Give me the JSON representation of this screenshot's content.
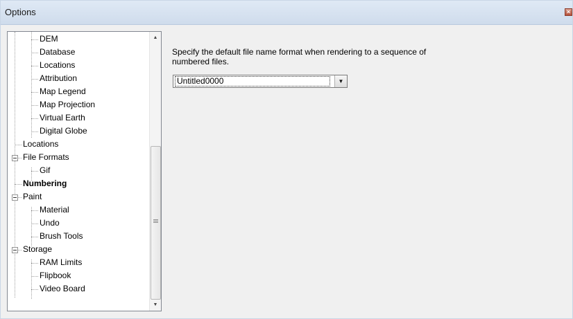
{
  "window": {
    "title": "Options",
    "close_icon": "close-icon"
  },
  "tree": {
    "items": [
      {
        "label": "DEM",
        "bold": false
      },
      {
        "label": "Database",
        "bold": false
      },
      {
        "label": "Locations",
        "bold": false
      },
      {
        "label": "Attribution",
        "bold": false
      },
      {
        "label": "Map Legend",
        "bold": false
      },
      {
        "label": "Map Projection",
        "bold": false
      },
      {
        "label": "Virtual Earth",
        "bold": false
      },
      {
        "label": "Digital Globe",
        "bold": false
      },
      {
        "label": "Locations",
        "bold": false
      },
      {
        "label": "File Formats",
        "bold": false
      },
      {
        "label": "Gif",
        "bold": false
      },
      {
        "label": "Numbering",
        "bold": true
      },
      {
        "label": "Paint",
        "bold": false
      },
      {
        "label": "Material",
        "bold": false
      },
      {
        "label": "Undo",
        "bold": false
      },
      {
        "label": "Brush Tools",
        "bold": false
      },
      {
        "label": "Storage",
        "bold": false
      },
      {
        "label": "RAM Limits",
        "bold": false
      },
      {
        "label": "Flipbook",
        "bold": false
      },
      {
        "label": "Video Board",
        "bold": false
      }
    ],
    "selected": "Numbering"
  },
  "panel": {
    "description": "Specify the default file name format when rendering to a sequence of numbered files.",
    "format_value": "Untitled0000"
  },
  "colors": {
    "titlebar": "#d6e2f0",
    "window": "#f0f0f0",
    "close": "#b5503a"
  }
}
